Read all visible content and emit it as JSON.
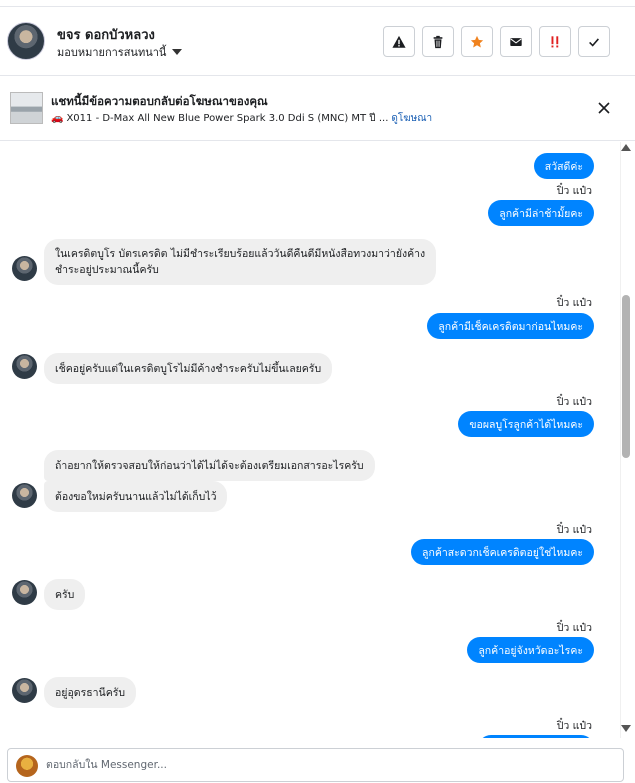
{
  "header": {
    "contact_name": "ขจร ดอกบัวหลวง",
    "assign_label": "มอบหมายการสนทนานี้",
    "actions": [
      {
        "icon": "warning-icon"
      },
      {
        "icon": "trash-icon"
      },
      {
        "icon": "star-icon"
      },
      {
        "icon": "mail-icon"
      },
      {
        "icon": "spam-icon"
      },
      {
        "icon": "check-icon"
      }
    ]
  },
  "ad": {
    "title": "แชทนี้มีข้อความตอบกลับต่อโฆษณาของคุณ",
    "car_emoji": "🚗",
    "description": "X011 - D-Max All New Blue Power Spark 3.0 Ddi S (MNC) MT ปี ...",
    "link_label": "ดูโฆษณา"
  },
  "messages": [
    {
      "dir": "out",
      "text": "สวัสดีค่ะ"
    },
    {
      "dir": "seen",
      "text": "ปิ๋ว แป๋ว"
    },
    {
      "dir": "out",
      "text": "ลูกค้ามีล่าช้ามั้ยคะ"
    },
    {
      "dir": "in",
      "text": "ในเครดิตบูโร บัตรเครดิต ไม่มีชำระเรียบร้อยแล้ววันดีคืนดีมีหนังสือทวงมาว่ายังค้าง\nชำระอยู่ประมาณนี้ครับ"
    },
    {
      "dir": "seen",
      "text": "ปิ๋ว แป๋ว"
    },
    {
      "dir": "out",
      "text": "ลูกค้ามีเช็คเครดิตมาก่อนไหมคะ"
    },
    {
      "dir": "in",
      "text": "เช็คอยู่ครับแต่ในเครดิตบูโรไม่มีค้างชำระครับไม่ขึ้นเลยครับ"
    },
    {
      "dir": "seen",
      "text": "ปิ๋ว แป๋ว"
    },
    {
      "dir": "out",
      "text": "ขอผลบูโรลูกค้าได้ไหมคะ"
    },
    {
      "dir": "in",
      "text": "ถ้าอยากให้ตรวจสอบให้ก่อนว่าได้ไม่ได้จะต้องเตรียมเอกสารอะไรครับ"
    },
    {
      "dir": "in",
      "text": "ต้องขอใหม่ครับนานแล้วไม่ได้เก็บไว้"
    },
    {
      "dir": "seen",
      "text": "ปิ๋ว แป๋ว"
    },
    {
      "dir": "out",
      "text": "ลูกค้าสะดวกเช็คเครดิตอยู่ใช่ไหมคะ"
    },
    {
      "dir": "in",
      "text": "ครับ"
    },
    {
      "dir": "seen",
      "text": "ปิ๋ว แป๋ว"
    },
    {
      "dir": "out",
      "text": "ลูกค้าอยู่จังหวัดอะไรคะ"
    },
    {
      "dir": "in",
      "text": "อยู่อุดรธานีครับ"
    },
    {
      "dir": "seen",
      "text": "ปิ๋ว แป๋ว"
    }
  ],
  "composer": {
    "placeholder": "ตอบกลับใน Messenger..."
  }
}
